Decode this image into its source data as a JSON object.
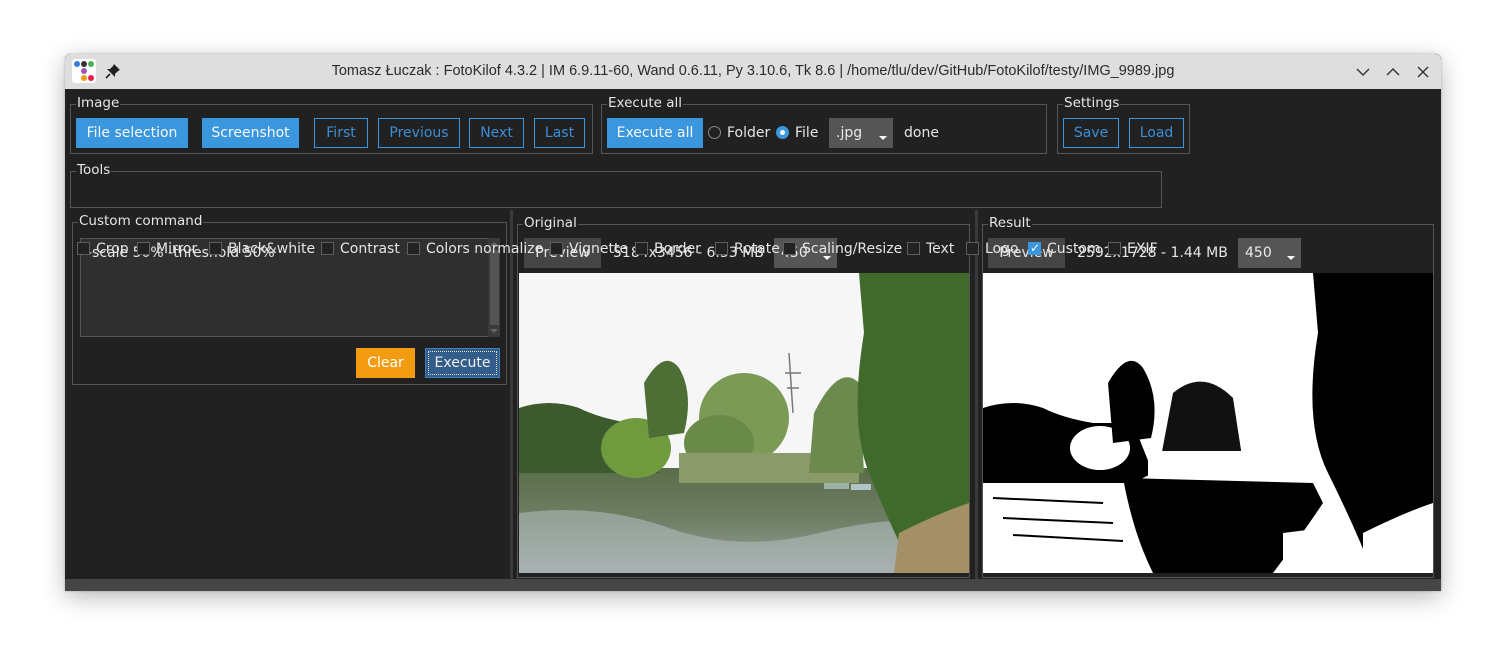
{
  "window": {
    "title": "Tomasz Łuczak : FotoKilof 4.3.2 | IM 6.9.11-60, Wand 0.6.11, Py 3.10.6, Tk 8.6 | /home/tlu/dev/GitHub/FotoKilof/testy/IMG_9989.jpg",
    "icons": {
      "app": "app-logo-icon",
      "pin": "pin-icon",
      "minimize": "chevron-down-icon",
      "maximize": "chevron-up-icon",
      "close": "close-icon"
    },
    "app_icon_colors": [
      "#3a7bd5",
      "#333333",
      "#4caf50",
      "#9b59b6",
      "#f39c12",
      "#e91e4a"
    ]
  },
  "image_frame": {
    "label": "Image",
    "buttons": {
      "file_selection": "File selection",
      "screenshot": "Screenshot",
      "first": "First",
      "previous": "Previous",
      "next": "Next",
      "last": "Last"
    }
  },
  "execute_all_frame": {
    "label": "Execute all",
    "button": "Execute all",
    "radio_folder": "Folder",
    "radio_file": "File",
    "selected_radio": "File",
    "extension_value": ".jpg",
    "status": "done"
  },
  "settings_frame": {
    "label": "Settings",
    "save": "Save",
    "load": "Load"
  },
  "tools": {
    "label": "Tools",
    "items": [
      {
        "label": "Crop",
        "checked": false
      },
      {
        "label": "Mirror",
        "checked": false
      },
      {
        "label": "Black&white",
        "checked": false
      },
      {
        "label": "Contrast",
        "checked": false
      },
      {
        "label": "Colors normalize",
        "checked": false
      },
      {
        "label": "Vignette",
        "checked": false
      },
      {
        "label": "Border",
        "checked": false
      },
      {
        "label": "Rotate",
        "checked": false
      },
      {
        "label": "Scaling/Resize",
        "checked": false
      },
      {
        "label": "Text",
        "checked": false
      },
      {
        "label": "Logo",
        "checked": false
      },
      {
        "label": "Custom",
        "checked": true
      },
      {
        "label": "EXIF",
        "checked": false
      }
    ]
  },
  "custom_command": {
    "label": "Custom command",
    "value": "-scale 50% -threshold 50%",
    "clear": "Clear",
    "execute": "Execute"
  },
  "original": {
    "label": "Original",
    "preview": "Preview",
    "info": "5184x3456 - 6.53 MB",
    "size_value": "450",
    "image_desc": "Lake with willow trees, reeds, boats and a power pylon (color)"
  },
  "result": {
    "label": "Result",
    "preview": "Preview",
    "info": "2592x1728 - 1.44 MB",
    "size_value": "450",
    "image_desc": "Same lake scene after threshold (black and white)"
  },
  "colors": {
    "accent": "#3b97dd",
    "orange": "#f39c12",
    "background": "#212121",
    "titlebar": "#dedede"
  }
}
